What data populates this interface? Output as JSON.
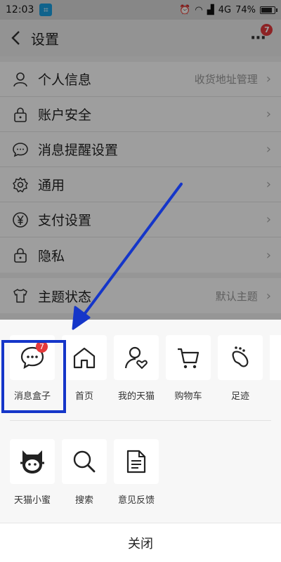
{
  "status_bar": {
    "time": "12:03",
    "network": "4G",
    "battery": "74%"
  },
  "header": {
    "title": "设置",
    "more_badge": "7"
  },
  "settings": {
    "items": [
      {
        "label": "个人信息",
        "hint": "收货地址管理",
        "icon": "person-icon"
      },
      {
        "label": "账户安全",
        "hint": "",
        "icon": "lock-icon"
      },
      {
        "label": "消息提醒设置",
        "hint": "",
        "icon": "chat-icon"
      },
      {
        "label": "通用",
        "hint": "",
        "icon": "gear-icon"
      },
      {
        "label": "支付设置",
        "hint": "",
        "icon": "yen-icon"
      },
      {
        "label": "隐私",
        "hint": "",
        "icon": "privacy-lock-icon"
      },
      {
        "label": "主题状态",
        "hint": "默认主题",
        "icon": "shirt-icon"
      }
    ]
  },
  "share_sheet": {
    "row1": [
      {
        "label": "消息盒子",
        "icon": "message-box-icon",
        "badge": "7"
      },
      {
        "label": "首页",
        "icon": "home-icon"
      },
      {
        "label": "我的天猫",
        "icon": "user-heart-icon"
      },
      {
        "label": "购物车",
        "icon": "cart-icon"
      },
      {
        "label": "足迹",
        "icon": "footprint-icon"
      }
    ],
    "row2": [
      {
        "label": "天猫小蜜",
        "icon": "tmall-assistant-icon"
      },
      {
        "label": "搜索",
        "icon": "search-icon"
      },
      {
        "label": "意见反馈",
        "icon": "feedback-doc-icon"
      }
    ],
    "close_label": "关闭"
  },
  "colors": {
    "highlight_box": "#1536c9",
    "arrow": "#1536c9",
    "badge": "#e4393c"
  }
}
